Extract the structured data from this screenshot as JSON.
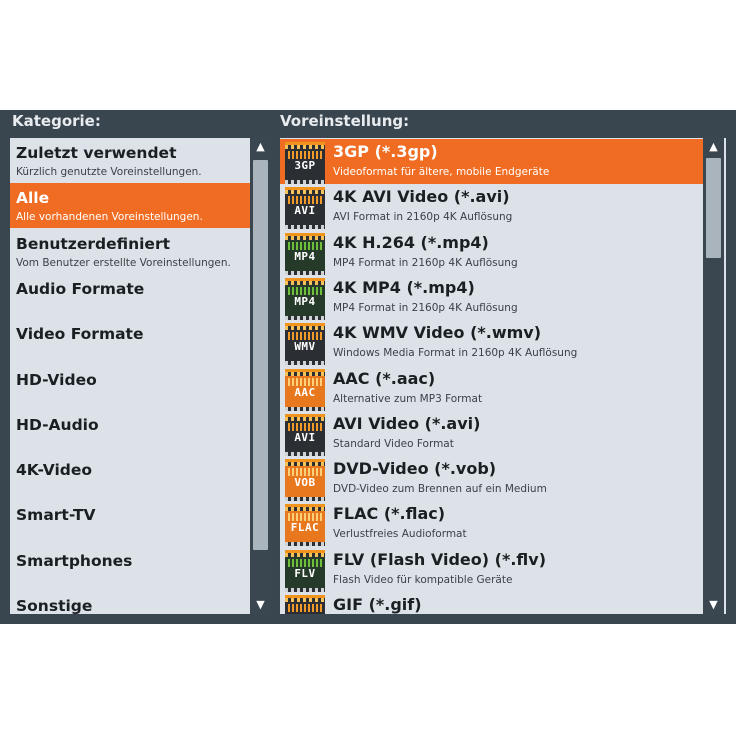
{
  "labels": {
    "category": "Kategorie:",
    "preset": "Voreinstellung:"
  },
  "categories": [
    {
      "title": "Zuletzt verwendet",
      "sub": "Kürzlich genutzte Voreinstellungen."
    },
    {
      "title": "Alle",
      "sub": "Alle vorhandenen Voreinstellungen.",
      "selected": true
    },
    {
      "title": "Benutzerdefiniert",
      "sub": "Vom Benutzer erstellte Voreinstellungen."
    },
    {
      "title": "Audio Formate",
      "sub": ""
    },
    {
      "title": "Video Formate",
      "sub": ""
    },
    {
      "title": "HD-Video",
      "sub": ""
    },
    {
      "title": "HD-Audio",
      "sub": ""
    },
    {
      "title": "4K-Video",
      "sub": ""
    },
    {
      "title": "Smart-TV",
      "sub": ""
    },
    {
      "title": "Smartphones",
      "sub": ""
    },
    {
      "title": "Sonstige",
      "sub": ""
    }
  ],
  "presets": [
    {
      "icon": "3GP",
      "title": "3GP (*.3gp)",
      "sub": "Videoformat für ältere, mobile Endgeräte",
      "selected": true
    },
    {
      "icon": "AVI",
      "title": "4K AVI Video (*.avi)",
      "sub": "AVI Format in 2160p 4K Auflösung"
    },
    {
      "icon": "MP4",
      "title": "4K H.264 (*.mp4)",
      "sub": "MP4 Format in 2160p 4K Auflösung"
    },
    {
      "icon": "MP4",
      "title": "4K MP4 (*.mp4)",
      "sub": "MP4 Format in 2160p 4K Auflösung"
    },
    {
      "icon": "WMV",
      "title": "4K WMV Video (*.wmv)",
      "sub": "Windows Media Format in 2160p 4K Auflösung"
    },
    {
      "icon": "AAC",
      "title": "AAC (*.aac)",
      "sub": "Alternative zum MP3 Format"
    },
    {
      "icon": "AVI",
      "title": "AVI Video (*.avi)",
      "sub": "Standard Video Format"
    },
    {
      "icon": "VOB",
      "title": "DVD-Video (*.vob)",
      "sub": "DVD-Video zum Brennen auf ein Medium"
    },
    {
      "icon": "FLAC",
      "title": "FLAC (*.flac)",
      "sub": "Verlustfreies Audioformat"
    },
    {
      "icon": "FLV",
      "title": "FLV (Flash Video) (*.flv)",
      "sub": "Flash Video für kompatible Geräte"
    },
    {
      "icon": "GIF",
      "title": "GIF (*.gif)",
      "sub": ""
    }
  ],
  "icons": {
    "scroll_up": "chevron-up-icon",
    "scroll_down": "chevron-down-icon"
  },
  "colors": {
    "accent": "#f06c22",
    "panel": "#dce2e7",
    "frame": "#39454f"
  }
}
